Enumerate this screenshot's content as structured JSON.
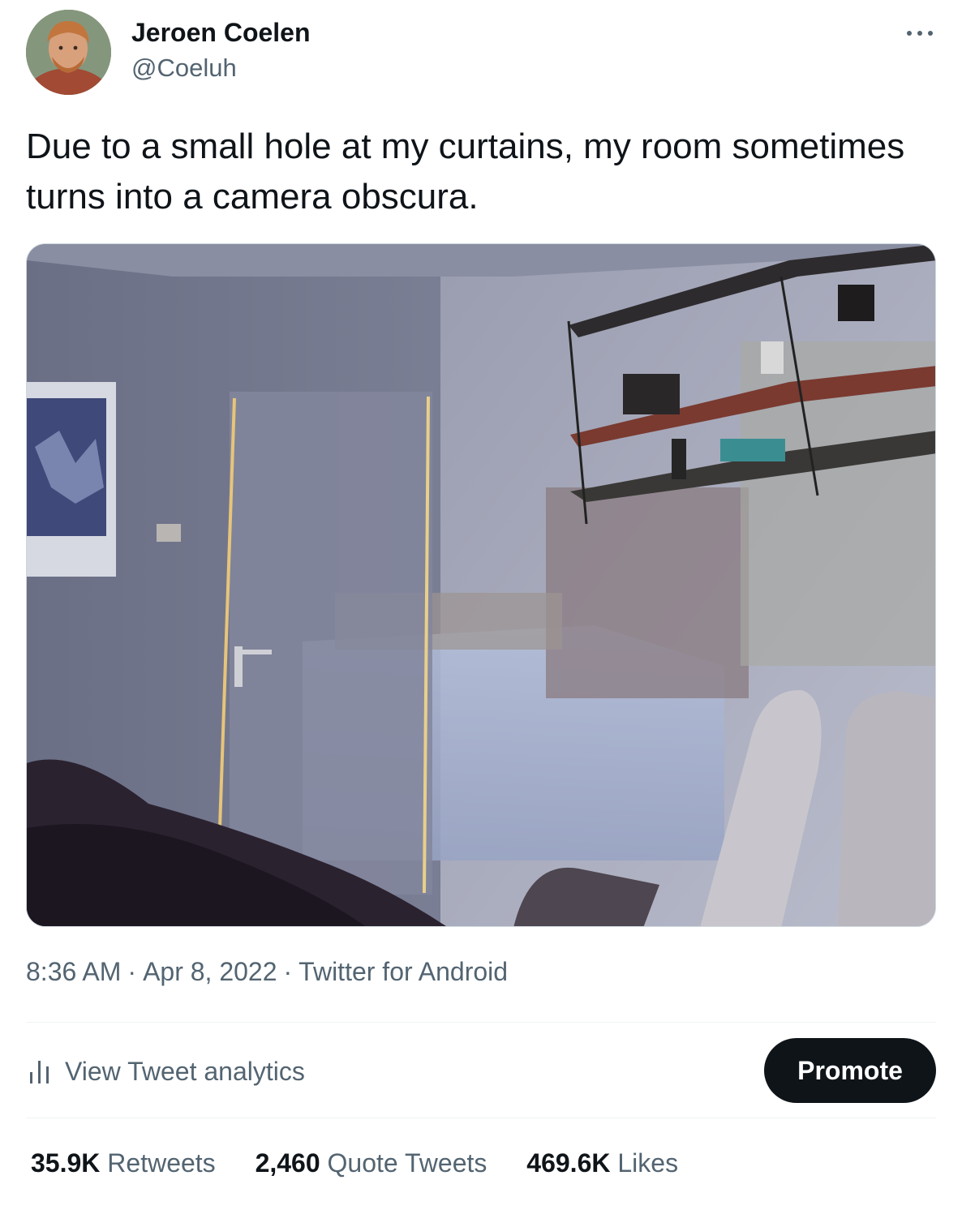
{
  "author": {
    "name": "Jeroen Coelen",
    "handle": "@Coeluh"
  },
  "tweet": {
    "text": "Due to a small hole at my curtains, my room sometimes turns into a camera obscura."
  },
  "meta": {
    "time": "8:36 AM",
    "date": "Apr 8, 2022",
    "source": "Twitter for Android",
    "separator": "·"
  },
  "actions": {
    "analytics_label": "View Tweet analytics",
    "promote_label": "Promote"
  },
  "stats": {
    "retweets_count": "35.9K",
    "retweets_label": "Retweets",
    "quotes_count": "2,460",
    "quotes_label": "Quote Tweets",
    "likes_count": "469.6K",
    "likes_label": "Likes"
  },
  "colors": {
    "text_primary": "#0f1419",
    "text_secondary": "#536471",
    "divider": "#eff3f4",
    "promote_bg": "#0f1419"
  },
  "icons": {
    "more": "more-horizontal-icon",
    "analytics": "bar-chart-icon"
  }
}
